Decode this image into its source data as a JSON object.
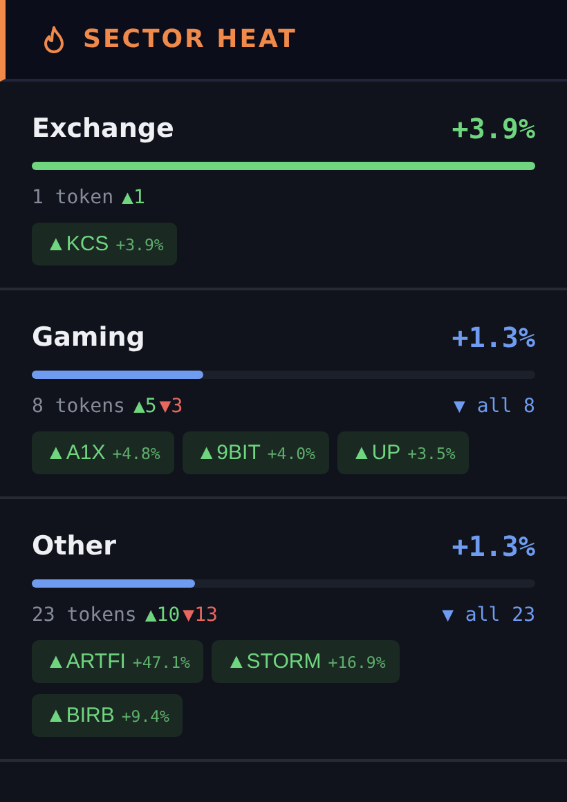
{
  "header": {
    "title": "SECTOR HEAT"
  },
  "sectors": [
    {
      "name": "Exchange",
      "change": "+3.9%",
      "color": "#6fd67f",
      "level": 1.0,
      "count": "1 token",
      "up": "▲1",
      "tokens": [
        {
          "symbol": "▲KCS",
          "change": "+3.9%"
        }
      ]
    },
    {
      "name": "Gaming",
      "change": "+1.3%",
      "color": "#6f9bf0",
      "level": 0.34,
      "count": "8 tokens",
      "up": "▲5",
      "down": "▼3",
      "expand": "▼ all 8",
      "tokens": [
        {
          "symbol": "▲A1X",
          "change": "+4.8%"
        },
        {
          "symbol": "▲9BIT",
          "change": "+4.0%"
        },
        {
          "symbol": "▲UP",
          "change": "+3.5%"
        }
      ]
    },
    {
      "name": "Other",
      "change": "+1.3%",
      "color": "#6f9bf0",
      "level": 0.325,
      "count": "23 tokens",
      "up": "▲10",
      "down": "▼13",
      "expand": "▼ all 23",
      "tokens": [
        {
          "symbol": "▲ARTFI",
          "change": "+47.1%"
        },
        {
          "symbol": "▲STORM",
          "change": "+16.9%"
        },
        {
          "symbol": "▲BIRB",
          "change": "+9.4%"
        }
      ]
    }
  ]
}
